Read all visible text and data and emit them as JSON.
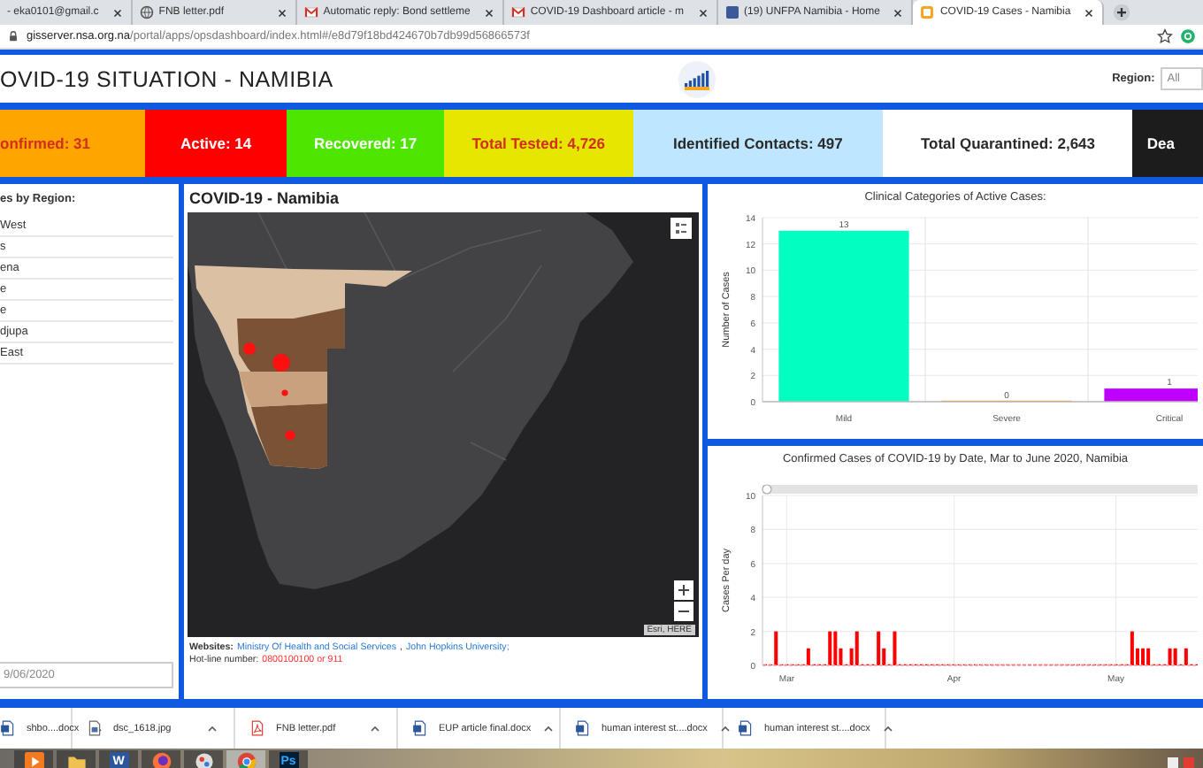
{
  "browser": {
    "tabs": [
      {
        "title": "- eka0101@gmail.c",
        "selected": false
      },
      {
        "title": "FNB letter.pdf",
        "kind": "globe",
        "selected": false
      },
      {
        "title": "Automatic reply: Bond settleme",
        "kind": "mail",
        "selected": false
      },
      {
        "title": "COVID-19 Dashboard article - m",
        "kind": "mail",
        "selected": false
      },
      {
        "title": "(19) UNFPA Namibia - Home",
        "kind": "site",
        "selected": false
      },
      {
        "title": "COVID-19 Cases - Namibia",
        "kind": "dashboard",
        "selected": true
      }
    ],
    "url_host": "gisserver.nsa.org.na",
    "url_path": "/portal/apps/opsdashboard/index.html#/e8d79f18bd424670b7db99d56866573f"
  },
  "header": {
    "title": "OVID-19 SITUATION - NAMIBIA",
    "region_label": "Region:",
    "region_value": "All"
  },
  "stats": [
    {
      "label": "onfirmed: 31",
      "color": "#ffa500",
      "kind": "alert"
    },
    {
      "label": "Active: 14",
      "color": "#ff0000",
      "kind": "light"
    },
    {
      "label": "Recovered: 17",
      "color": "#4ee600",
      "kind": "light"
    },
    {
      "label": "Total Tested: 4,726",
      "color": "#e6e600",
      "kind": "alert"
    },
    {
      "label": "Identified Contacts: 497",
      "color": "#bfe6ff",
      "kind": "dark"
    },
    {
      "label": "Total Quarantined: 2,643",
      "color": "#ffffff",
      "kind": "dark"
    },
    {
      "label": "Dea",
      "color": "#1c1c1c",
      "kind": "light"
    }
  ],
  "region_list": {
    "title": "es by Region:",
    "items": [
      {
        "name": "West"
      },
      {
        "name": "s"
      },
      {
        "name": "ena"
      },
      {
        "name": "e"
      },
      {
        "name": "e"
      },
      {
        "name": "djupa"
      },
      {
        "name": "East"
      }
    ],
    "date": "9/06/2020"
  },
  "map_panel": {
    "title": "COVID-19 - Namibia",
    "attribution": "Esri, HERE",
    "websites_label": "Websites:",
    "links": [
      "Ministry Of Health and Social Services",
      "John Hopkins University;"
    ],
    "separator": ",",
    "hotline_label": "Hot-line number:",
    "hotline": "0800100100 or 911"
  },
  "clinical_panel": {
    "chart_data": {
      "type": "bar",
      "title": "Clinical Categories of Active Cases:",
      "ylabel": "Number of Cases",
      "categories": [
        "Mild",
        "Severe",
        "Critical"
      ],
      "stacked": true,
      "grid": true,
      "data_labels": true,
      "ylim": [
        0,
        14
      ],
      "yticks": [
        0,
        2,
        4,
        6,
        8,
        10,
        12,
        14
      ],
      "series": [
        {
          "color": "#00ffc0",
          "values": [
            13,
            null,
            null
          ]
        },
        {
          "color": "#ff8c00",
          "values": [
            null,
            0,
            null
          ]
        },
        {
          "color": "#c000ff",
          "values": [
            null,
            null,
            1
          ]
        }
      ]
    }
  },
  "daily_panel": {
    "chart_data": {
      "type": "bar",
      "title": "Confirmed Cases of COVID-19 by Date, Mar to June 2020, Namibia",
      "ylabel": "Cases Per day",
      "ylim": [
        0,
        10
      ],
      "yticks": [
        0,
        2,
        4,
        6,
        8,
        10
      ],
      "grid": true,
      "categories": [
        null,
        null,
        null,
        null,
        "Mar",
        null,
        null,
        null,
        null,
        null,
        null,
        null,
        null,
        null,
        null,
        null,
        null,
        null,
        null,
        null,
        null,
        null,
        null,
        null,
        null,
        null,
        null,
        null,
        null,
        null,
        null,
        null,
        null,
        null,
        null,
        "Apr",
        null,
        null,
        null,
        null,
        null,
        null,
        null,
        null,
        null,
        null,
        null,
        null,
        null,
        null,
        null,
        null,
        null,
        null,
        null,
        null,
        null,
        null,
        null,
        null,
        null,
        null,
        null,
        null,
        null,
        "May",
        null,
        null,
        null,
        null,
        null,
        null,
        null,
        null,
        null,
        null,
        null,
        null,
        null,
        null,
        null,
        null
      ],
      "series": [
        {
          "color": "#ff0000",
          "values": [
            0,
            0,
            2,
            0,
            0,
            0,
            0,
            0,
            1,
            0,
            0,
            0,
            2,
            2,
            1,
            0,
            1,
            2,
            0,
            0,
            0,
            2,
            1,
            0,
            2,
            0,
            0,
            0,
            0,
            0,
            0,
            0,
            0,
            0,
            0,
            0,
            0,
            0,
            0,
            0,
            0,
            0,
            0,
            0,
            0,
            0,
            0,
            0,
            0,
            0,
            0,
            0,
            0,
            0,
            0,
            0,
            0,
            0,
            0,
            0,
            0,
            0,
            0,
            0,
            0,
            0,
            0,
            0,
            2,
            1,
            1,
            1,
            0,
            0,
            0,
            1,
            1,
            0,
            1,
            0,
            0,
            0
          ]
        }
      ]
    }
  },
  "downloads": [
    {
      "name": "shbo....docx",
      "kind": "doc"
    },
    {
      "name": "dsc_1618.jpg",
      "kind": "image"
    },
    {
      "name": "FNB letter.pdf",
      "kind": "pdf"
    },
    {
      "name": "EUP article final.docx",
      "kind": "doc"
    },
    {
      "name": "human interest st....docx",
      "kind": "doc"
    },
    {
      "name": "human interest st....docx",
      "kind": "doc"
    }
  ],
  "taskbar": [
    {
      "kind": "media",
      "selected": false
    },
    {
      "kind": "folder",
      "selected": false
    },
    {
      "kind": "word",
      "label": "W",
      "selected": false
    },
    {
      "kind": "firefox",
      "selected": false
    },
    {
      "kind": "paint",
      "selected": false
    },
    {
      "kind": "chrome",
      "selected": true
    },
    {
      "kind": "photoshop",
      "label": "Ps",
      "selected": false
    }
  ]
}
